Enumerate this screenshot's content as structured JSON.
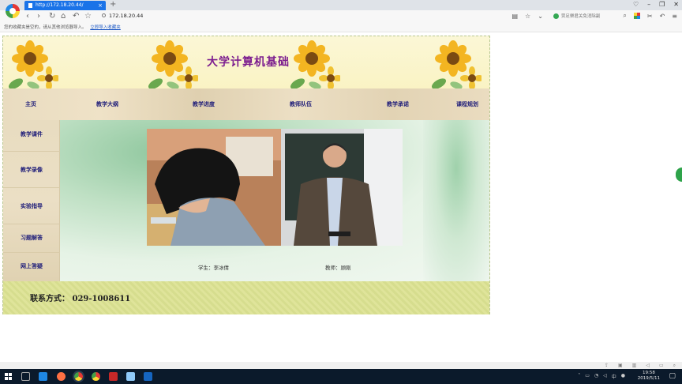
{
  "browser": {
    "tab_title": "http://172.18.20.44/",
    "url": "172.18.20.44",
    "search_placeholder": "贾足樂君关免消除副",
    "bookmark_notice": "您的收藏夹是空的，请从其他浏览器导入。",
    "bookmark_link": "立即导入收藏夹"
  },
  "site": {
    "title": "大学计算机基础",
    "nav": [
      "主页",
      "教学大纲",
      "教学进度",
      "教师队伍",
      "教学承诺",
      "课程规划"
    ],
    "sidebar": [
      "教学课件",
      "教学录像",
      "实验指导",
      "习题解答",
      "网上答疑"
    ],
    "student_caption": "学生：李冰倩",
    "teacher_caption": "教师：顾刚",
    "contact": "联系方式： 029-1008611"
  },
  "taskbar": {
    "time": "19:58",
    "date": "2019/5/11",
    "ime": "中"
  }
}
